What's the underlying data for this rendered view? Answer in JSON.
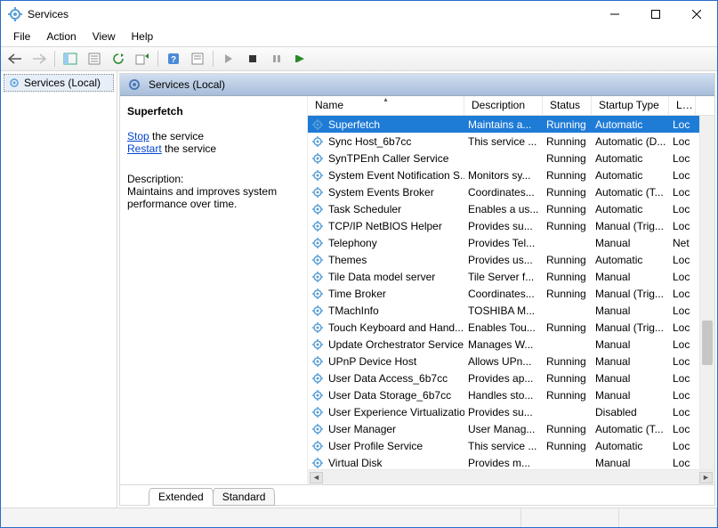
{
  "window": {
    "title": "Services"
  },
  "menu": {
    "file": "File",
    "action": "Action",
    "view": "View",
    "help": "Help"
  },
  "tree": {
    "root": "Services (Local)"
  },
  "panel": {
    "heading": "Services (Local)",
    "selected_name": "Superfetch",
    "stop_link": "Stop",
    "stop_suffix": " the service",
    "restart_link": "Restart",
    "restart_suffix": " the service",
    "desc_label": "Description:",
    "desc_text": "Maintains and improves system performance over time."
  },
  "columns": {
    "name": "Name",
    "description": "Description",
    "status": "Status",
    "startup": "Startup Type",
    "logon": "Log"
  },
  "col_widths": {
    "name": 176,
    "desc": 88,
    "status": 55,
    "startup": 87,
    "logon": 30
  },
  "rows": [
    {
      "name": "Superfetch",
      "desc": "Maintains a...",
      "status": "Running",
      "startup": "Automatic",
      "logon": "Loc",
      "selected": true
    },
    {
      "name": "Sync Host_6b7cc",
      "desc": "This service ...",
      "status": "Running",
      "startup": "Automatic (D...",
      "logon": "Loc"
    },
    {
      "name": "SynTPEnh Caller Service",
      "desc": "",
      "status": "Running",
      "startup": "Automatic",
      "logon": "Loc"
    },
    {
      "name": "System Event Notification S...",
      "desc": "Monitors sy...",
      "status": "Running",
      "startup": "Automatic",
      "logon": "Loc"
    },
    {
      "name": "System Events Broker",
      "desc": "Coordinates...",
      "status": "Running",
      "startup": "Automatic (T...",
      "logon": "Loc"
    },
    {
      "name": "Task Scheduler",
      "desc": "Enables a us...",
      "status": "Running",
      "startup": "Automatic",
      "logon": "Loc"
    },
    {
      "name": "TCP/IP NetBIOS Helper",
      "desc": "Provides su...",
      "status": "Running",
      "startup": "Manual (Trig...",
      "logon": "Loc"
    },
    {
      "name": "Telephony",
      "desc": "Provides Tel...",
      "status": "",
      "startup": "Manual",
      "logon": "Net"
    },
    {
      "name": "Themes",
      "desc": "Provides us...",
      "status": "Running",
      "startup": "Automatic",
      "logon": "Loc"
    },
    {
      "name": "Tile Data model server",
      "desc": "Tile Server f...",
      "status": "Running",
      "startup": "Manual",
      "logon": "Loc"
    },
    {
      "name": "Time Broker",
      "desc": "Coordinates...",
      "status": "Running",
      "startup": "Manual (Trig...",
      "logon": "Loc"
    },
    {
      "name": "TMachInfo",
      "desc": "TOSHIBA M...",
      "status": "",
      "startup": "Manual",
      "logon": "Loc"
    },
    {
      "name": "Touch Keyboard and Hand...",
      "desc": "Enables Tou...",
      "status": "Running",
      "startup": "Manual (Trig...",
      "logon": "Loc"
    },
    {
      "name": "Update Orchestrator Service",
      "desc": "Manages W...",
      "status": "",
      "startup": "Manual",
      "logon": "Loc"
    },
    {
      "name": "UPnP Device Host",
      "desc": "Allows UPn...",
      "status": "Running",
      "startup": "Manual",
      "logon": "Loc"
    },
    {
      "name": "User Data Access_6b7cc",
      "desc": "Provides ap...",
      "status": "Running",
      "startup": "Manual",
      "logon": "Loc"
    },
    {
      "name": "User Data Storage_6b7cc",
      "desc": "Handles sto...",
      "status": "Running",
      "startup": "Manual",
      "logon": "Loc"
    },
    {
      "name": "User Experience Virtualizatio...",
      "desc": "Provides su...",
      "status": "",
      "startup": "Disabled",
      "logon": "Loc"
    },
    {
      "name": "User Manager",
      "desc": "User Manag...",
      "status": "Running",
      "startup": "Automatic (T...",
      "logon": "Loc"
    },
    {
      "name": "User Profile Service",
      "desc": "This service ...",
      "status": "Running",
      "startup": "Automatic",
      "logon": "Loc"
    },
    {
      "name": "Virtual Disk",
      "desc": "Provides m...",
      "status": "",
      "startup": "Manual",
      "logon": "Loc"
    }
  ],
  "tabs": {
    "extended": "Extended",
    "standard": "Standard"
  }
}
